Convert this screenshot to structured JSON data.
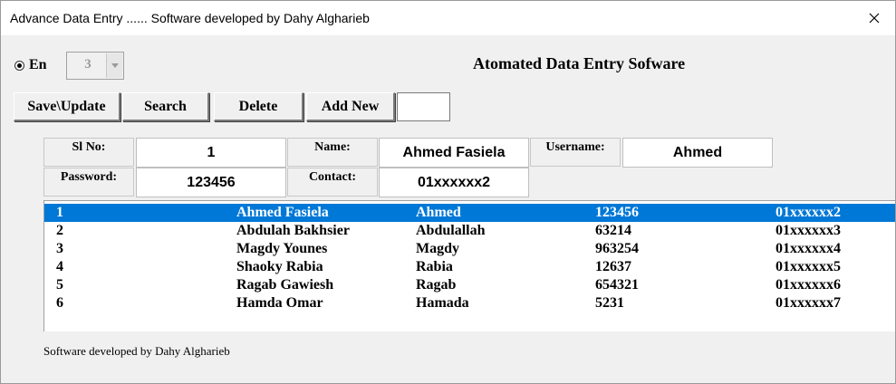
{
  "window": {
    "title": "Advance Data Entry ...... Software developed by Dahy Algharieb"
  },
  "language": {
    "label": "En",
    "selected": true
  },
  "combo": {
    "value": "3"
  },
  "heading": "Atomated Data Entry Sofware",
  "buttons": {
    "save": "Save\\Update",
    "search": "Search",
    "delete": "Delete",
    "add_new": "Add New"
  },
  "form": {
    "sl_label": "Sl No:",
    "sl_value": "1",
    "name_label": "Name:",
    "name_value": "Ahmed Fasiela",
    "username_label": "Username:",
    "username_value": "Ahmed",
    "password_label": "Password:",
    "password_value": "123456",
    "contact_label": "Contact:",
    "contact_value": "01xxxxxx2"
  },
  "records": [
    [
      "1",
      "Ahmed Fasiela",
      "Ahmed",
      "123456",
      "01xxxxxx2"
    ],
    [
      "2",
      "Abdulah Bakhsier",
      "Abdulallah",
      "63214",
      "01xxxxxx3"
    ],
    [
      "3",
      "Magdy Younes",
      "Magdy",
      "963254",
      "01xxxxxx4"
    ],
    [
      "4",
      "Shaoky Rabia",
      "Rabia",
      "12637",
      "01xxxxxx5"
    ],
    [
      "5",
      "Ragab Gawiesh",
      "Ragab",
      "654321",
      "01xxxxxx6"
    ],
    [
      "6",
      "Hamda Omar",
      "Hamada",
      "5231",
      "01xxxxxx7"
    ]
  ],
  "footer": "Software developed by Dahy Algharieb",
  "colors": {
    "selection": "#0078d7",
    "background": "#f0f0f0"
  }
}
